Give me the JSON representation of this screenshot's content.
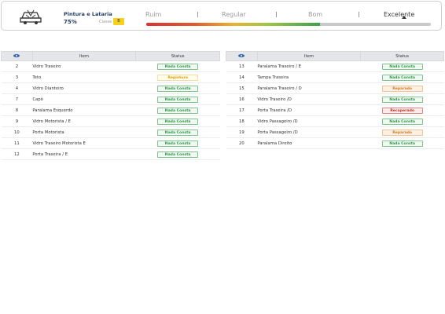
{
  "header": {
    "icon": "car-damage-icon",
    "category_title": "Pintura e Lataria",
    "percent": "75%",
    "classe_label": "Classe",
    "classe_value": "B",
    "scale": [
      "Ruim",
      "Regular",
      "Bom",
      "Excelente"
    ],
    "scale_active": "Excelente",
    "progress": 0.61
  },
  "table_headers": {
    "eye": "eye-icon",
    "item": "Item",
    "status": "Status"
  },
  "left_rows": [
    {
      "num": "2",
      "item": "Vidro Traseiro",
      "status": "Nada Consta",
      "kind": "ok"
    },
    {
      "num": "3",
      "item": "Teto",
      "status": "Repintura",
      "kind": "rep"
    },
    {
      "num": "4",
      "item": "Vidro Dianteiro",
      "status": "Nada Consta",
      "kind": "ok"
    },
    {
      "num": "7",
      "item": "Capô",
      "status": "Nada Consta",
      "kind": "ok"
    },
    {
      "num": "8",
      "item": "Paralama Esquerdo",
      "status": "Nada Consta",
      "kind": "ok"
    },
    {
      "num": "9",
      "item": "Vidro Motorista / E",
      "status": "Nada Consta",
      "kind": "ok"
    },
    {
      "num": "10",
      "item": "Porta Motorista",
      "status": "Nada Consta",
      "kind": "ok"
    },
    {
      "num": "11",
      "item": "Vidro Traseiro Motorista E",
      "status": "Nada Consta",
      "kind": "ok"
    },
    {
      "num": "12",
      "item": "Porta Traseira / E",
      "status": "Nada Consta",
      "kind": "ok"
    }
  ],
  "right_rows": [
    {
      "num": "13",
      "item": "Paralama Traseiro / E",
      "status": "Nada Consta",
      "kind": "ok"
    },
    {
      "num": "14",
      "item": "Tampa Traseira",
      "status": "Nada Consta",
      "kind": "ok"
    },
    {
      "num": "15",
      "item": "Paralama Traseiro / D",
      "status": "Reparado",
      "kind": "fix"
    },
    {
      "num": "16",
      "item": "Vidro Traseiro /D",
      "status": "Nada Consta",
      "kind": "ok"
    },
    {
      "num": "17",
      "item": "Porta Traseira /D",
      "status": "Recuperado",
      "kind": "rec"
    },
    {
      "num": "18",
      "item": "Vidro Passageiro /D",
      "status": "Nada Consta",
      "kind": "ok"
    },
    {
      "num": "19",
      "item": "Porta Passageiro /D",
      "status": "Reparado",
      "kind": "fix"
    },
    {
      "num": "20",
      "item": "Paralama Direito",
      "status": "Nada Consta",
      "kind": "ok"
    }
  ]
}
